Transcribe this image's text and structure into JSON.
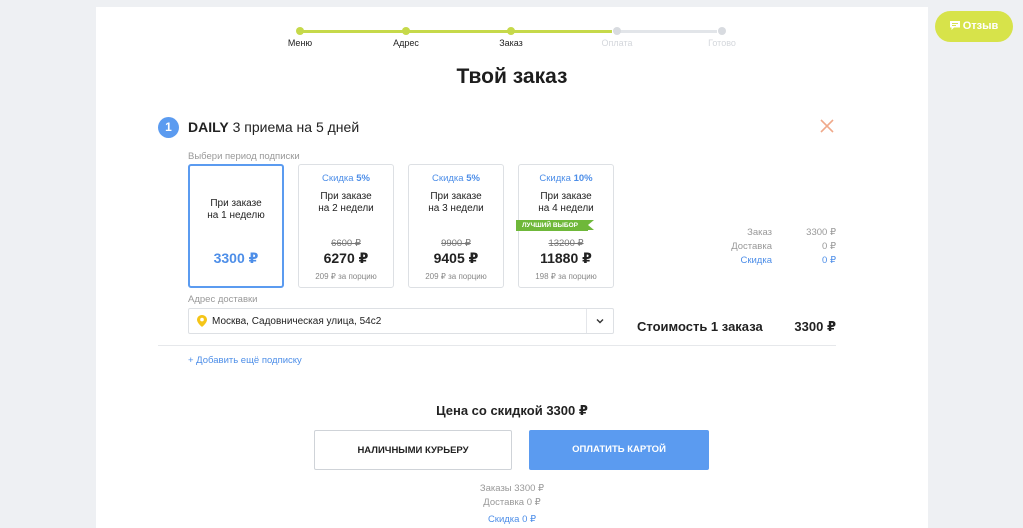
{
  "progress": {
    "steps": [
      "Меню",
      "Адрес",
      "Заказ",
      "Оплата",
      "Готово"
    ],
    "completed": 3
  },
  "title": "Твой заказ",
  "subscription": {
    "number": "1",
    "plan_name": "DAILY",
    "plan_desc": "3 приема на 5 дней",
    "period_hint": "Выбери период подписки",
    "options": [
      {
        "discount_prefix": "",
        "discount_value": "",
        "line1": "При заказе",
        "line2": "на 1 неделю",
        "old_price": "",
        "price": "3300 ₽",
        "per_portion": "",
        "selected": true
      },
      {
        "discount_prefix": "Скидка",
        "discount_value": "5%",
        "line1": "При заказе",
        "line2": "на 2 недели",
        "old_price": "6600 ₽",
        "price": "6270 ₽",
        "per_portion": "209 ₽ за порцию",
        "selected": false
      },
      {
        "discount_prefix": "Скидка",
        "discount_value": "5%",
        "line1": "При заказе",
        "line2": "на 3 недели",
        "old_price": "9900 ₽",
        "price": "9405 ₽",
        "per_portion": "209 ₽ за порцию",
        "selected": false
      },
      {
        "discount_prefix": "Скидка",
        "discount_value": "10%",
        "line1": "При заказе",
        "line2": "на 4 недели",
        "old_price": "13200 ₽",
        "price": "11880 ₽",
        "per_portion": "198 ₽ за порцию",
        "selected": false
      }
    ],
    "best_choice": "ЛУЧШИЙ ВЫБОР",
    "summary": {
      "order_label": "Заказ",
      "order_value": "3300 ₽",
      "delivery_label": "Доставка",
      "delivery_value": "0 ₽",
      "discount_label": "Скидка",
      "discount_value": "0 ₽"
    },
    "address_label": "Адрес доставки",
    "address": "Москва, Садовническая улица, 54с2",
    "cost_label": "Стоимость 1 заказа",
    "cost_value": "3300 ₽"
  },
  "add_subscription": "+ Добавить ещё подписку",
  "discount_price": "Цена со скидкой 3300 ₽",
  "buttons": {
    "cash": "НАЛИЧНЫМИ КУРЬЕРУ",
    "card": "ОПЛАТИТЬ КАРТОЙ"
  },
  "footer": {
    "orders": "Заказы 3300 ₽",
    "delivery": "Доставка 0 ₽",
    "discount": "Скидка 0 ₽"
  },
  "review_button": "Отзыв",
  "colors": {
    "accent_blue": "#5b9bf0",
    "progress_green": "#c6d94a",
    "best_green": "#6fb83a",
    "review_yellow": "#d7e34a"
  }
}
